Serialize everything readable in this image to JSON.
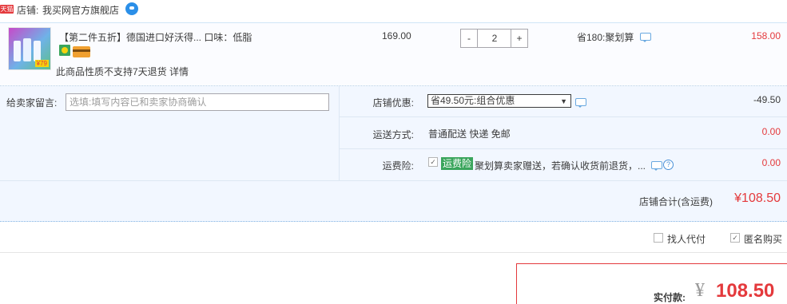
{
  "shop": {
    "badge": "天猫",
    "prefix": "店铺:",
    "name": "我买网官方旗舰店",
    "contact_icon": "wangwang-icon"
  },
  "item": {
    "thumb_price_tag": "¥79",
    "title": "【第二件五折】德国进口好沃得... 口味：低脂",
    "unit_price": "169.00",
    "quantity": "2",
    "qty_minus": "-",
    "qty_plus": "+",
    "promo": "省180:聚划算",
    "subtotal": "158.00",
    "note": "此商品性质不支持7天退货 详情"
  },
  "message": {
    "label": "给卖家留言:",
    "placeholder": "选填:填写内容已和卖家协商确认"
  },
  "coupon": {
    "label": "店铺优惠:",
    "selected": "省49.50元:组合优惠",
    "amount": "-49.50"
  },
  "shipping": {
    "label": "运送方式:",
    "value": "普通配送 快递 免邮",
    "amount": "0.00"
  },
  "insurance": {
    "label": "运费险:",
    "tag": "运费险",
    "description": "聚划算卖家赠送，若确认收货前退货，...",
    "amount": "0.00",
    "checked": true
  },
  "shop_total": {
    "label": "店铺合计(含运费)",
    "value": "¥108.50"
  },
  "extra_options": {
    "proxy_pay": "找人代付",
    "proxy_pay_checked": false,
    "anonymous": "匿名购买",
    "anonymous_checked": true
  },
  "payment": {
    "label": "实付款:",
    "currency": "¥",
    "value": "108.50"
  },
  "colors": {
    "accent_red": "#e4393c",
    "border_blue": "#b7d0e6",
    "panel_bg": "#f2f7ff",
    "insurance_green": "#3aa55c"
  }
}
